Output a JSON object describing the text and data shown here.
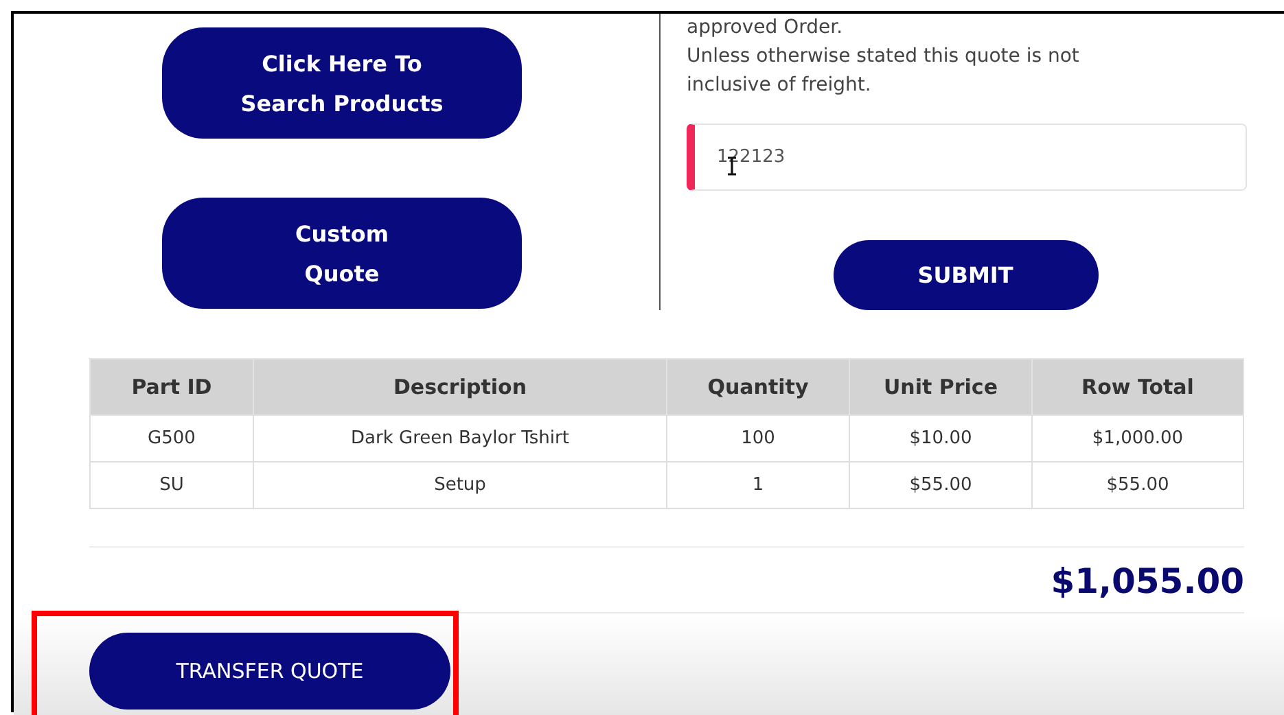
{
  "actions": [
    {
      "label": "Click Here To\nSearch Products"
    },
    {
      "label": "Custom\nQuote"
    }
  ],
  "notice": "approved Order.\nUnless otherwise stated this quote is not inclusive of freight.",
  "quote_field": {
    "value": "122123",
    "invalid": true
  },
  "submit": {
    "label": "SUBMIT"
  },
  "table": {
    "columns": [
      "Part ID",
      "Description",
      "Quantity",
      "Unit Price",
      "Row Total"
    ],
    "rows": [
      [
        "G500",
        "Dark Green Baylor Tshirt",
        "100",
        "$10.00",
        "$1,000.00"
      ],
      [
        "SU",
        "Setup",
        "1",
        "$55.00",
        "$55.00"
      ]
    ]
  },
  "total": "$1,055.00",
  "transfer_button": {
    "label": "TRANSFER QUOTE",
    "highlighted": true
  }
}
